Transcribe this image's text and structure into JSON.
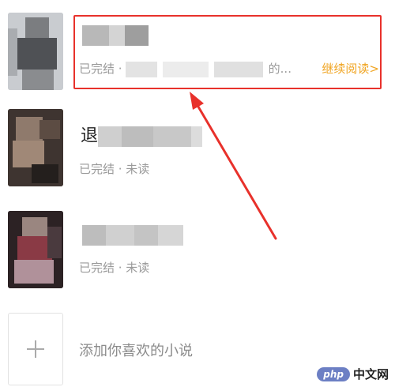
{
  "colors": {
    "accent": "#f0a523",
    "highlight": "#e8312b",
    "meta": "#9a9a9a"
  },
  "books": [
    {
      "status": "已完结 · ",
      "progress_suffix": "的...",
      "continue_label": "继续阅读>"
    },
    {
      "title_prefix": "退",
      "status": "已完结 · 未读"
    },
    {
      "status": "已完结 · 未读"
    }
  ],
  "add_novel": {
    "icon": "plus-icon",
    "label": "添加你喜欢的小说"
  },
  "watermark": {
    "badge": "php",
    "text": "中文网"
  }
}
